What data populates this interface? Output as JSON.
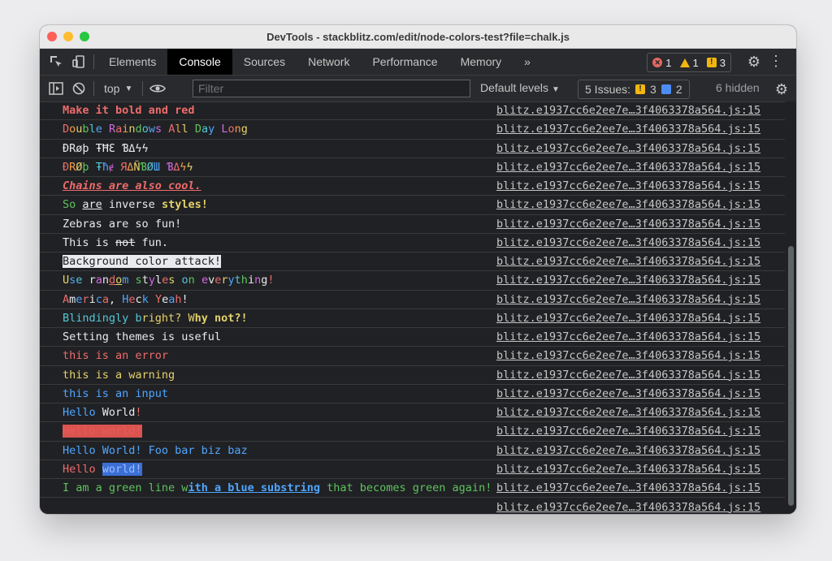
{
  "window": {
    "title": "DevTools - stackblitz.com/edit/node-colors-test?file=chalk.js"
  },
  "tabs": [
    {
      "label": "Elements",
      "active": false
    },
    {
      "label": "Console",
      "active": true
    },
    {
      "label": "Sources",
      "active": false
    },
    {
      "label": "Network",
      "active": false
    },
    {
      "label": "Performance",
      "active": false
    },
    {
      "label": "Memory",
      "active": false
    }
  ],
  "more_tabs": "»",
  "counters": {
    "errors": "1",
    "warnings": "1",
    "issues": "3"
  },
  "toolbar": {
    "context": "top",
    "filter_placeholder": "Filter",
    "levels": "Default levels",
    "issues_label": "5 Issues:",
    "issues_warn": "3",
    "issues_info": "2",
    "hidden": "6 hidden"
  },
  "source": "blitz.e1937cc6e2ee7e…3f4063378a564.js:15",
  "colors": {
    "background": "#202124",
    "red": "#ee6b6b",
    "yellow": "#e5d26b",
    "green": "#5ec35e",
    "blue": "#4fa6ff"
  },
  "console_lines": [
    "Make it bold and red",
    "Double Raindows All Day Long",
    "ÐRøþ ŦĦƐ ƁΔϟϟ",
    "ÐRØþ Ŧħɇ ЯΔÑƁØШ ƁΔϟϟ",
    "Chains are also cool.",
    "So are inverse styles!",
    "Zebras are so fun!",
    "This is not fun.",
    "Background color attack!",
    "Use random styles on everything!",
    "America, Heck Yeah!",
    "Blindingly bright? Why not?!",
    "Setting themes is useful",
    "this is an error",
    "this is a warning",
    "this is an input",
    "Hello World!",
    "Hello world!",
    "Hello World! Foo bar biz baz",
    "Hello world!",
    "I am a green line with a blue substring that becomes green again!"
  ]
}
